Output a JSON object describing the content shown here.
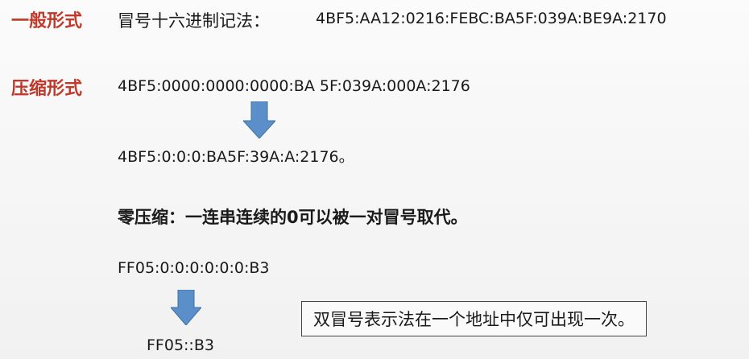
{
  "general": {
    "label": "一般形式",
    "desc": "冒号十六进制记法：",
    "address": "4BF5:AA12:0216:FEBC:BA5F:039A:BE9A:2170"
  },
  "compressed": {
    "label": "压缩形式",
    "full": "4BF5:0000:0000:0000:BA 5F:039A:000A:2176",
    "short": "4BF5:0:0:0:BA5F:39A:A:2176。"
  },
  "zero_compression": {
    "rule": "零压缩：一连串连续的0可以被一对冒号取代。",
    "full": "FF05:0:0:0:0:0:0:B3",
    "short": "FF05::B3",
    "note": "双冒号表示法在一个地址中仅可出现一次。"
  },
  "colors": {
    "label_red": "#c0392b",
    "arrow_blue": "#5b8fc9"
  }
}
